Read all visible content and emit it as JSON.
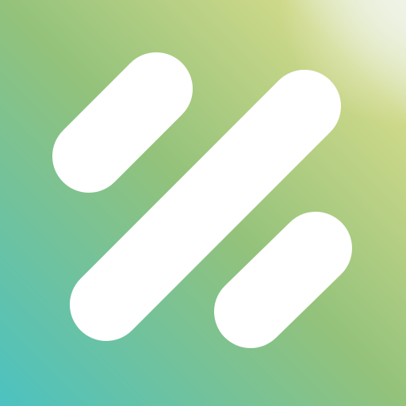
{
  "icon": {
    "name": "app-logo-icon",
    "description_colors": {
      "gradient_bottom_left": "#4cc2c1",
      "gradient_middle": "#93c27b",
      "gradient_upper_right": "#cfd98a",
      "gradient_corner_highlight": "#eef3e6",
      "stroke_color": "#ffffff"
    }
  }
}
